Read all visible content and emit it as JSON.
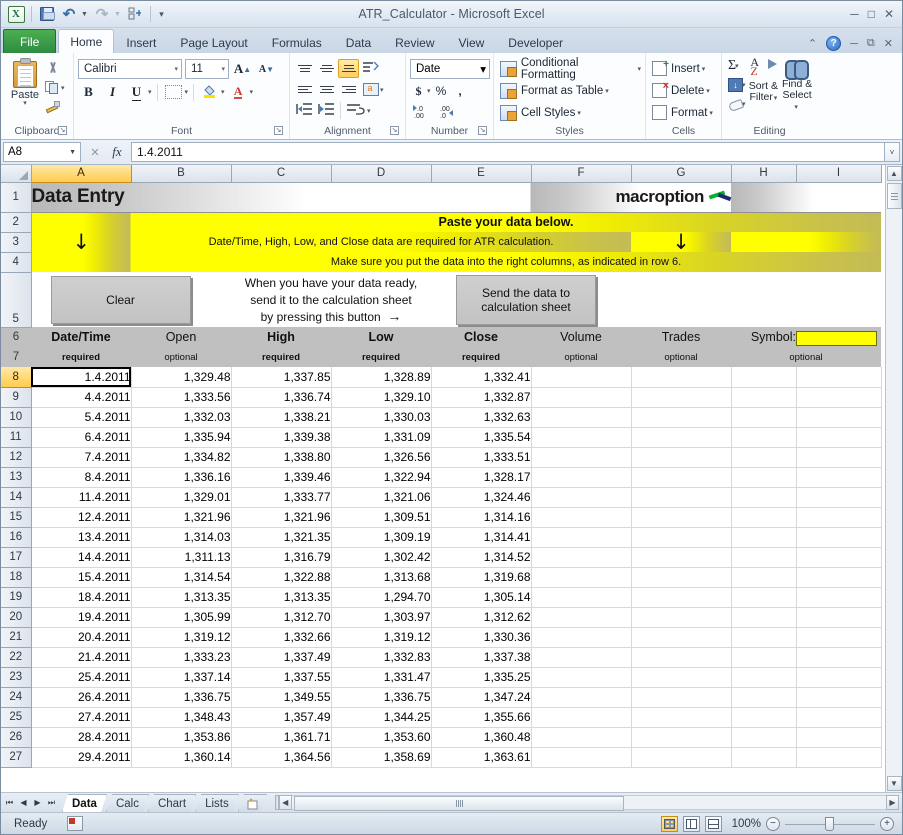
{
  "window": {
    "title": "ATR_Calculator  -  Microsoft Excel",
    "minimize": "─",
    "restore": "□",
    "close": "✕"
  },
  "quick_access": {
    "excel_logo": "X",
    "items": [
      "save-icon",
      "undo-icon",
      "redo-icon",
      "customize-icon"
    ]
  },
  "ribbon_tabs": [
    {
      "label": "File",
      "active": false
    },
    {
      "label": "Home",
      "active": true
    },
    {
      "label": "Insert",
      "active": false
    },
    {
      "label": "Page Layout",
      "active": false
    },
    {
      "label": "Formulas",
      "active": false
    },
    {
      "label": "Data",
      "active": false
    },
    {
      "label": "Review",
      "active": false
    },
    {
      "label": "View",
      "active": false
    },
    {
      "label": "Developer",
      "active": false
    }
  ],
  "ribbon_right": {
    "collapse": "⌃",
    "help": "?",
    "minimize": "─",
    "restore": "⧉",
    "close": "✕"
  },
  "ribbon": {
    "clipboard": {
      "label": "Clipboard",
      "paste": "Paste",
      "cut": "cut-icon",
      "copy": "copy-icon",
      "format_painter": "format-painter-icon",
      "dialog_launcher": "↘"
    },
    "font": {
      "label": "Font",
      "font_name": "Calibri",
      "font_size": "11",
      "grow_font": "A",
      "shrink_font": "A",
      "bold": "B",
      "italic": "I",
      "underline": "U",
      "borders": "borders-icon",
      "fill_color": "fill-color-icon",
      "font_color": "font-color-icon",
      "dialog_launcher": "↘"
    },
    "alignment": {
      "label": "Alignment",
      "top_align": "top-align-icon",
      "middle_align": "middle-align-icon",
      "bottom_align": "bottom-align-icon",
      "orientation": "orientation-icon",
      "align_left": "align-left-icon",
      "align_center": "align-center-icon",
      "align_right": "align-right-icon",
      "wrap_text": "wrap-text-icon",
      "decrease_indent": "decrease-indent-icon",
      "increase_indent": "increase-indent-icon",
      "merge_center": "merge-center-icon",
      "dialog_launcher": "↘"
    },
    "number": {
      "label": "Number",
      "format": "Date",
      "accounting": "$",
      "percent": "%",
      "comma": ",",
      "increase_decimal": "increase-decimal-icon",
      "decrease_decimal": "decrease-decimal-icon",
      "dialog_launcher": "↘"
    },
    "styles": {
      "label": "Styles",
      "conditional_formatting": "Conditional Formatting",
      "format_as_table": "Format as Table",
      "cell_styles": "Cell Styles",
      "caret": "▾"
    },
    "cells": {
      "label": "Cells",
      "insert": "Insert",
      "delete": "Delete",
      "format": "Format",
      "caret": "▾"
    },
    "editing": {
      "label": "Editing",
      "autosum": "Σ",
      "fill": "fill-icon",
      "clear": "clear-icon",
      "sort_filter": "Sort &\nFilter",
      "sort_filter_l1": "Sort &",
      "sort_filter_l2": "Filter",
      "find_select_l1": "Find &",
      "find_select_l2": "Select",
      "caret": "▾"
    }
  },
  "formula_bar": {
    "name_box": "A8",
    "cancel": "✕",
    "enter": "✓",
    "fx": "fx",
    "value": "1.4.2011",
    "expand": "˅"
  },
  "grid": {
    "columns": [
      "A",
      "B",
      "C",
      "D",
      "E",
      "F",
      "G",
      "H",
      "I"
    ],
    "selected_column": "A",
    "selected_row": 8,
    "selected_cell": "A8",
    "row_numbers": [
      1,
      2,
      3,
      4,
      5,
      6,
      7,
      8,
      9,
      10,
      11,
      12,
      13,
      14,
      15,
      16,
      17,
      18,
      19,
      20,
      21,
      22,
      23,
      24,
      25,
      26,
      27
    ],
    "sheet_title": "Data Entry",
    "logo_text": "macroption",
    "banner": {
      "line1": "Paste your data below.",
      "line2": "Date/Time, High, Low, and Close data are required for ATR calculation.",
      "line3": "Make sure you put the data into the right columns, as indicated in row 6.",
      "arrow": "↓"
    },
    "buttons": {
      "clear": "Clear",
      "send_l1": "Send the data to",
      "send_l2": "calculation sheet"
    },
    "instruction": {
      "l1": "When you have your data ready,",
      "l2": "send it to the calculation sheet",
      "l3": "by pressing this button",
      "arrow": "→"
    },
    "headers_main": [
      "Date/Time",
      "Open",
      "High",
      "Low",
      "Close",
      "Volume",
      "Trades"
    ],
    "headers_sub": [
      "required",
      "optional",
      "required",
      "required",
      "required",
      "optional",
      "optional"
    ],
    "symbol_label": "Symbol:",
    "symbol_sub": "optional",
    "symbol_value": "",
    "data_columns": [
      "Date/Time",
      "Open",
      "High",
      "Low",
      "Close",
      "Volume",
      "Trades"
    ],
    "rows": [
      {
        "row": 8,
        "date": "1.4.2011",
        "open": "1,329.48",
        "high": "1,337.85",
        "low": "1,328.89",
        "close": "1,332.41"
      },
      {
        "row": 9,
        "date": "4.4.2011",
        "open": "1,333.56",
        "high": "1,336.74",
        "low": "1,329.10",
        "close": "1,332.87"
      },
      {
        "row": 10,
        "date": "5.4.2011",
        "open": "1,332.03",
        "high": "1,338.21",
        "low": "1,330.03",
        "close": "1,332.63"
      },
      {
        "row": 11,
        "date": "6.4.2011",
        "open": "1,335.94",
        "high": "1,339.38",
        "low": "1,331.09",
        "close": "1,335.54"
      },
      {
        "row": 12,
        "date": "7.4.2011",
        "open": "1,334.82",
        "high": "1,338.80",
        "low": "1,326.56",
        "close": "1,333.51"
      },
      {
        "row": 13,
        "date": "8.4.2011",
        "open": "1,336.16",
        "high": "1,339.46",
        "low": "1,322.94",
        "close": "1,328.17"
      },
      {
        "row": 14,
        "date": "11.4.2011",
        "open": "1,329.01",
        "high": "1,333.77",
        "low": "1,321.06",
        "close": "1,324.46"
      },
      {
        "row": 15,
        "date": "12.4.2011",
        "open": "1,321.96",
        "high": "1,321.96",
        "low": "1,309.51",
        "close": "1,314.16"
      },
      {
        "row": 16,
        "date": "13.4.2011",
        "open": "1,314.03",
        "high": "1,321.35",
        "low": "1,309.19",
        "close": "1,314.41"
      },
      {
        "row": 17,
        "date": "14.4.2011",
        "open": "1,311.13",
        "high": "1,316.79",
        "low": "1,302.42",
        "close": "1,314.52"
      },
      {
        "row": 18,
        "date": "15.4.2011",
        "open": "1,314.54",
        "high": "1,322.88",
        "low": "1,313.68",
        "close": "1,319.68"
      },
      {
        "row": 19,
        "date": "18.4.2011",
        "open": "1,313.35",
        "high": "1,313.35",
        "low": "1,294.70",
        "close": "1,305.14"
      },
      {
        "row": 20,
        "date": "19.4.2011",
        "open": "1,305.99",
        "high": "1,312.70",
        "low": "1,303.97",
        "close": "1,312.62"
      },
      {
        "row": 21,
        "date": "20.4.2011",
        "open": "1,319.12",
        "high": "1,332.66",
        "low": "1,319.12",
        "close": "1,330.36"
      },
      {
        "row": 22,
        "date": "21.4.2011",
        "open": "1,333.23",
        "high": "1,337.49",
        "low": "1,332.83",
        "close": "1,337.38"
      },
      {
        "row": 23,
        "date": "25.4.2011",
        "open": "1,337.14",
        "high": "1,337.55",
        "low": "1,331.47",
        "close": "1,335.25"
      },
      {
        "row": 24,
        "date": "26.4.2011",
        "open": "1,336.75",
        "high": "1,349.55",
        "low": "1,336.75",
        "close": "1,347.24"
      },
      {
        "row": 25,
        "date": "27.4.2011",
        "open": "1,348.43",
        "high": "1,357.49",
        "low": "1,344.25",
        "close": "1,355.66"
      },
      {
        "row": 26,
        "date": "28.4.2011",
        "open": "1,353.86",
        "high": "1,361.71",
        "low": "1,353.60",
        "close": "1,360.48"
      },
      {
        "row": 27,
        "date": "29.4.2011",
        "open": "1,360.14",
        "high": "1,364.56",
        "low": "1,358.69",
        "close": "1,363.61"
      }
    ]
  },
  "sheet_tabs": {
    "nav_first": "⏮",
    "nav_prev": "◀",
    "nav_next": "▶",
    "nav_last": "⏭",
    "tabs": [
      {
        "label": "Data",
        "active": true
      },
      {
        "label": "Calc",
        "active": false
      },
      {
        "label": "Chart",
        "active": false
      },
      {
        "label": "Lists",
        "active": false
      }
    ],
    "insert_tab": "insert-worksheet-icon"
  },
  "status_bar": {
    "state": "Ready",
    "macro_record": "record-macro-icon",
    "view_normal": "normal-view-icon",
    "view_layout": "page-layout-view-icon",
    "view_break": "page-break-view-icon",
    "zoom": "100%",
    "zoom_out": "−",
    "zoom_in": "+"
  },
  "colors": {
    "accent_yellow": "#ffff00",
    "excel_green": "#2e8b42",
    "header_gray": "#c0c0c0",
    "selection": "#ffcc4d"
  }
}
